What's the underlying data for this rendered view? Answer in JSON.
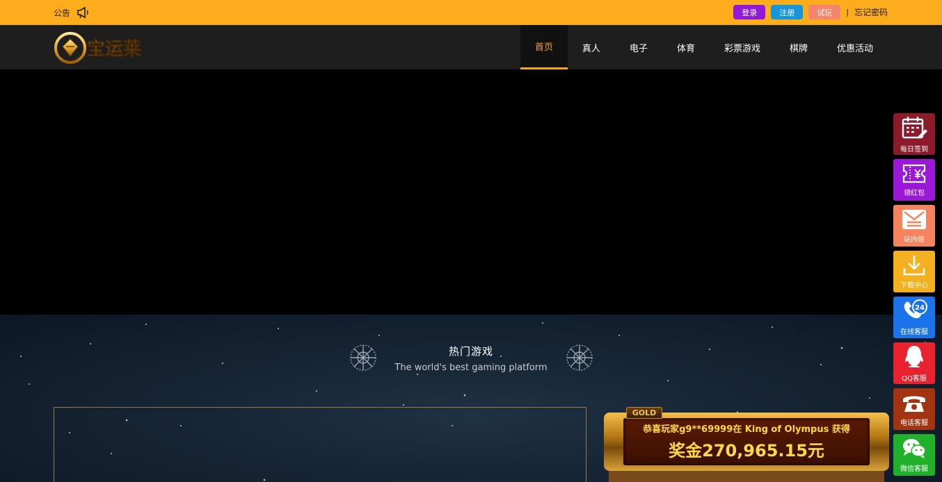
{
  "topbar": {
    "notice_label": "公告",
    "buttons": [
      {
        "label": "登录",
        "color": "#8f1ad8"
      },
      {
        "label": "注册",
        "color": "#1696d8"
      },
      {
        "label": "试玩",
        "color": "#f5866b"
      }
    ],
    "separator": "|",
    "link": "忘记密码"
  },
  "navbar": {
    "logo_text": "宝运莱",
    "items": [
      "首页",
      "真人",
      "电子",
      "体育",
      "彩票游戏",
      "棋牌",
      "优惠活动"
    ],
    "active_index": 0
  },
  "section": {
    "title": "热门游戏",
    "subtitle": "The world's best gaming platform"
  },
  "jackpot": {
    "tab": "GOLD",
    "winner_line": "恭喜玩家g9**69999在 King of Olympus 获得",
    "amount": "奖金270,965.15元"
  },
  "sidebar": {
    "items": [
      {
        "label": "每日签到",
        "color": "#8b1a2b",
        "icon": "calendar-icon"
      },
      {
        "label": "领红包",
        "color": "#9b19d6",
        "icon": "coupon-icon"
      },
      {
        "label": "站内信",
        "color": "#f4845f",
        "icon": "message-icon"
      },
      {
        "label": "下载中心",
        "color": "#f4b01e",
        "icon": "download-icon"
      },
      {
        "label": "在线客服",
        "color": "#1a73e8",
        "icon": "phone-24-icon"
      },
      {
        "label": "QQ客服",
        "color": "#e8232f",
        "icon": "qq-icon"
      },
      {
        "label": "电话客服",
        "color": "#a33412",
        "icon": "telephone-icon"
      },
      {
        "label": "微信客服",
        "color": "#21b02a",
        "icon": "wechat-icon"
      }
    ]
  }
}
